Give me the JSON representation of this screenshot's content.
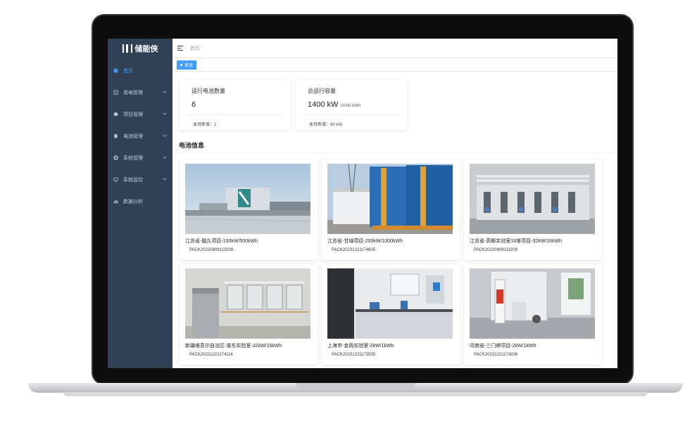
{
  "sidebar": {
    "logo": "储能侠",
    "items": [
      {
        "label": "首页",
        "icon": "dashboard-icon",
        "active": true
      },
      {
        "label": "用电管理",
        "icon": "list-icon"
      },
      {
        "label": "项目管理",
        "icon": "cube-icon"
      },
      {
        "label": "电池管理",
        "icon": "document-icon"
      },
      {
        "label": "系统管理",
        "icon": "gear-icon"
      },
      {
        "label": "系统监控",
        "icon": "monitor-icon"
      },
      {
        "label": "数据分析",
        "icon": "bar-chart-icon"
      }
    ]
  },
  "navbar": {
    "breadcrumb": "首页"
  },
  "tags": [
    {
      "label": "首页",
      "active": true
    }
  ],
  "stats": [
    {
      "title": "运行电池数量",
      "value": "6",
      "unit": "",
      "foot": "本月新增：1"
    },
    {
      "title": "总运行容量",
      "value": "1400 kW",
      "unit": "/2000 kWh",
      "foot": "本月新增：80 kW"
    }
  ],
  "section_title": "电池信息",
  "projects": [
    {
      "name": "江苏省-融久项目-100kW/500kWh",
      "code": "PACK20220809113208"
    },
    {
      "name": "江苏省-甘缐项目-200kW/1000kWh",
      "code": "PACK20231221174605"
    },
    {
      "name": "江苏省-高邮实验室16堆项目-32kW/16kWh",
      "code": "PACK20220809113209"
    },
    {
      "name": "新疆维吾尔自治区-准东实验室-32kW/16kWh",
      "code": "PACK20231221174114"
    },
    {
      "name": "上海市-金雨实验室-2kW/1kWh",
      "code": "PACK20231221173535"
    },
    {
      "name": "河南省-三门峡项目-2kW/1kWh",
      "code": "PACK20231221174336"
    }
  ],
  "colors": {
    "sidebar_bg": "#304156",
    "accent": "#409eff",
    "menu_text": "#bfcbd9"
  }
}
